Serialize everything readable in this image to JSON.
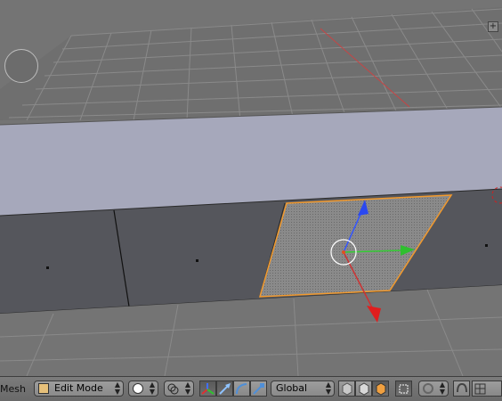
{
  "header": {
    "mesh_label": "Mesh",
    "mode_label": "Edit Mode",
    "orientation_label": "Global"
  },
  "icons": {
    "mode": "edit-mode-icon",
    "shading": "viewport-shading-icon",
    "pivot": "pivot-point-icon",
    "manipulator": "manipulator-toggle-icon",
    "translate": "translate-manipulator-icon",
    "rotate": "rotate-manipulator-icon",
    "scale": "scale-manipulator-icon",
    "vertex": "vertex-select-icon",
    "edge": "edge-select-icon",
    "face": "face-select-icon",
    "occlude": "limit-selection-icon",
    "proportional": "proportional-edit-icon",
    "snap": "snap-icon",
    "snap_target": "snap-element-icon"
  },
  "colors": {
    "x_axis": "#cc3333",
    "y_axis": "#33cc33",
    "z_axis": "#3355ff",
    "selection": "#f29a2e"
  }
}
